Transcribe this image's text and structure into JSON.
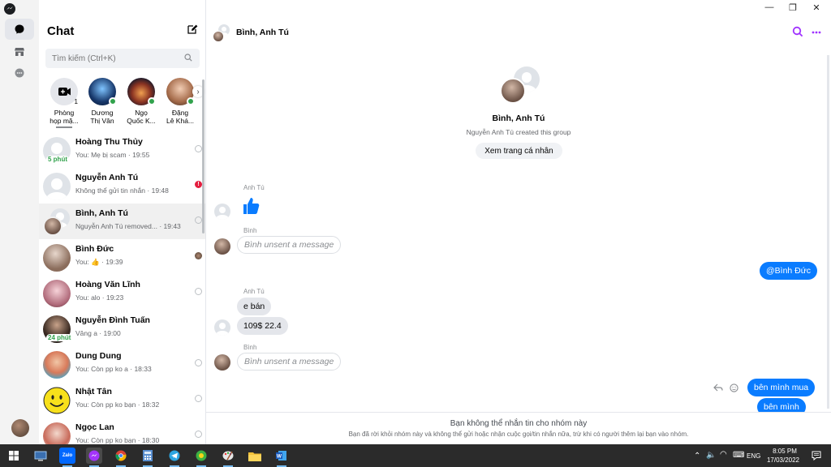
{
  "rail": {
    "icons": [
      "messenger-logo-icon",
      "chat-icon",
      "marketplace-icon",
      "message-requests-icon"
    ]
  },
  "sidebar": {
    "title": "Chat",
    "search_placeholder": "Tìm kiếm (Ctrl+K)",
    "stories": [
      {
        "label": "Phòng\nhọp mặ...",
        "badge": "1"
      },
      {
        "label": "Dương\nThị Vân"
      },
      {
        "label": "Ngọ\nQuốc K..."
      },
      {
        "label": "Đặng\nLê Khá..."
      }
    ],
    "conversations": [
      {
        "name": "Hoàng Thu Thủy",
        "preview": "You: Mẹ bị scam · 19:55",
        "badge": "5 phút"
      },
      {
        "name": "Nguyễn Anh Tú",
        "preview": "Không thể gửi tin nhắn · 19:48",
        "status": "!"
      },
      {
        "name": "Bình, Anh Tú",
        "preview": "Nguyễn Anh Tú removed... · 19:43"
      },
      {
        "name": "Bình Đức",
        "preview": "You: 👍 · 19:39"
      },
      {
        "name": "Hoàng Văn Lĩnh",
        "preview": "You: alo · 19:23"
      },
      {
        "name": "Nguyễn Đình Tuấn",
        "preview": "Vâng a · 19:00",
        "badge": "24 phút"
      },
      {
        "name": "Dung Dung",
        "preview": "You: Còn pp ko a · 18:33"
      },
      {
        "name": "Nhật Tân",
        "preview": "You: Còn pp ko bạn · 18:32"
      },
      {
        "name": "Ngọc Lan",
        "preview": "You: Còn pp ko bạn · 18:30"
      }
    ]
  },
  "window": {
    "minimize": "—",
    "maximize": "❐",
    "close": "✕"
  },
  "header": {
    "name": "Bình, Anh Tú"
  },
  "thread": {
    "intro_name": "Bình, Anh Tú",
    "intro_sub": "Nguyễn Anh Tú created this group",
    "profile_button": "Xem trang cá nhân",
    "sender_anhtu": "Anh Tú",
    "sender_binh": "Bình",
    "unsent_1": "Bình unsent a message",
    "mention": "@Bình Đức",
    "msg_eban": "e bán",
    "msg_price": "109$ 22.4",
    "unsent_2": "Bình unsent a message",
    "msg_last": "bên mình mua",
    "msg_partial": "bên mình"
  },
  "footer": {
    "title": "Bạn không thể nhắn tin cho nhóm này",
    "subtitle": "Bạn đã rời khỏi nhóm này và không thể gửi hoặc nhận cuộc gọi/tin nhắn nữa, trừ khi có người thêm lại bạn vào nhóm."
  },
  "taskbar": {
    "apps": [
      "windows-start-icon",
      "desktop-icon",
      "zalo-icon",
      "messenger-icon",
      "chrome-icon",
      "calculator-icon",
      "telegram-icon",
      "app-icon",
      "paint-icon",
      "file-explorer-icon",
      "word-icon"
    ],
    "lang": "ENG",
    "time": "8:05 PM",
    "date": "17/03/2022"
  },
  "colors": {
    "accent": "#0a7cff",
    "online": "#31a24c",
    "error": "#e41e3f",
    "purple": "#a033ff"
  }
}
